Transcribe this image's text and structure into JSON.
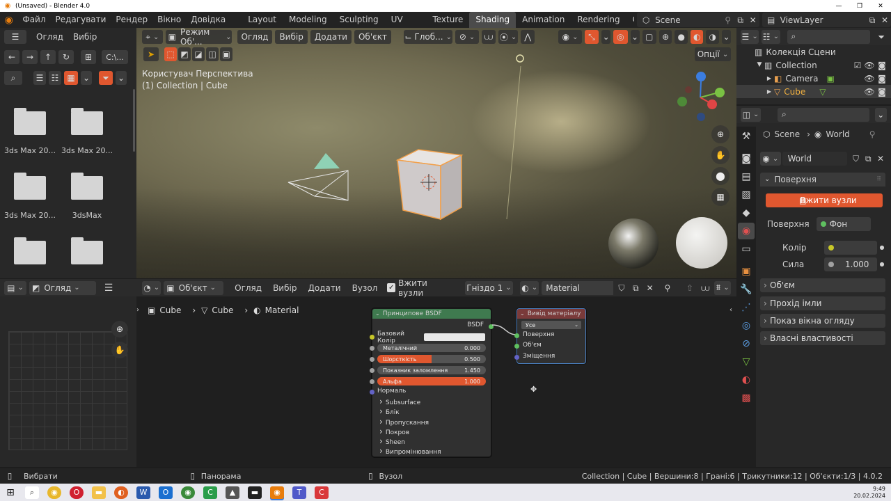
{
  "window": {
    "title": "(Unsaved) - Blender 4.0",
    "min": "—",
    "max": "❐",
    "close": "✕"
  },
  "topbar": {
    "menus": [
      "Файл",
      "Редагувати",
      "Рендер",
      "Вікно",
      "Довідка"
    ],
    "workspaces": [
      "Layout",
      "Modeling",
      "Sculpting",
      "UV Editing",
      "Texture Paint",
      "Shading",
      "Animation",
      "Rendering",
      "Com"
    ],
    "active_workspace": "Shading",
    "scene": "Scene",
    "viewlayer": "ViewLayer"
  },
  "filebrowser": {
    "menu_view": "Огляд",
    "menu_select": "Вибір",
    "path": "C:\\...",
    "folders": [
      "3ds Max 20...",
      "3ds Max 20...",
      "3ds Max 20...",
      "3dsMax",
      "",
      ""
    ]
  },
  "viewport": {
    "mode": "Режим Об'...",
    "menus": [
      "Огляд",
      "Вибір",
      "Додати",
      "Об'єкт"
    ],
    "orientation": "Глоб...",
    "options": "Опції",
    "info_line1": "Користувач Перспектива",
    "info_line2": "(1) Collection | Cube",
    "gizmo": {
      "z": "Z",
      "y": "Y",
      "x": "X"
    }
  },
  "outliner": {
    "root": "Колекція Сцени",
    "items": [
      {
        "label": "Collection"
      },
      {
        "label": "Camera"
      },
      {
        "label": "Cube"
      }
    ]
  },
  "props": {
    "breadcrumb_scene": "Scene",
    "breadcrumb_world": "World",
    "world_name": "World",
    "panel_surface": "Поверхня",
    "use_nodes_button": "Вжити вузли",
    "surface_label": "Поверхня",
    "surface_value": "Фон",
    "color_label": "Колір",
    "strength_label": "Сила",
    "strength_value": "1.000",
    "sections": [
      "Об'єм",
      "Прохід імли",
      "Показ вікна огляду",
      "Власні властивості"
    ]
  },
  "leftbottom": {
    "view_label": "Огляд"
  },
  "nodeeditor": {
    "type": "Об'єкт",
    "menus": [
      "Огляд",
      "Вибір",
      "Додати",
      "Вузол"
    ],
    "use_nodes": "Вжити вузли",
    "slot": "Гніздо 1",
    "material": "Material",
    "breadcrumb": [
      "Cube",
      "Cube",
      "Material"
    ],
    "bsdf": {
      "title": "Принципове BSDF",
      "output": "BSDF",
      "base_color": "Базовий Колір",
      "rows": [
        {
          "label": "Металічний",
          "value": "0.000"
        },
        {
          "label": "Шорсткість",
          "value": "0.500"
        },
        {
          "label": "Показник заломлення",
          "value": "1.450"
        },
        {
          "label": "Альфа",
          "value": "1.000"
        }
      ],
      "normal": "Нормаль",
      "subpanels": [
        "Subsurface",
        "Блік",
        "Пропускання",
        "Покров",
        "Sheen",
        "Випромінювання"
      ]
    },
    "output_node": {
      "title": "Вивід матеріалу",
      "target": "Усе",
      "inputs": [
        "Поверхня",
        "Об'єм",
        "Зміщення"
      ]
    }
  },
  "statusbar": {
    "select": "Вибрати",
    "pan": "Панорама",
    "node": "Вузол",
    "stats": "Collection | Cube | Вершини:8 | Грані:6 | Трикутники:12 | Об'єкти:1/3 | 4.0.2"
  },
  "taskbar": {
    "time": "9:49",
    "date": "20.02.2024"
  },
  "colors": {
    "accent_orange": "#e0572f",
    "node_green": "#3f7a4f",
    "node_red": "#7a3a3a"
  }
}
